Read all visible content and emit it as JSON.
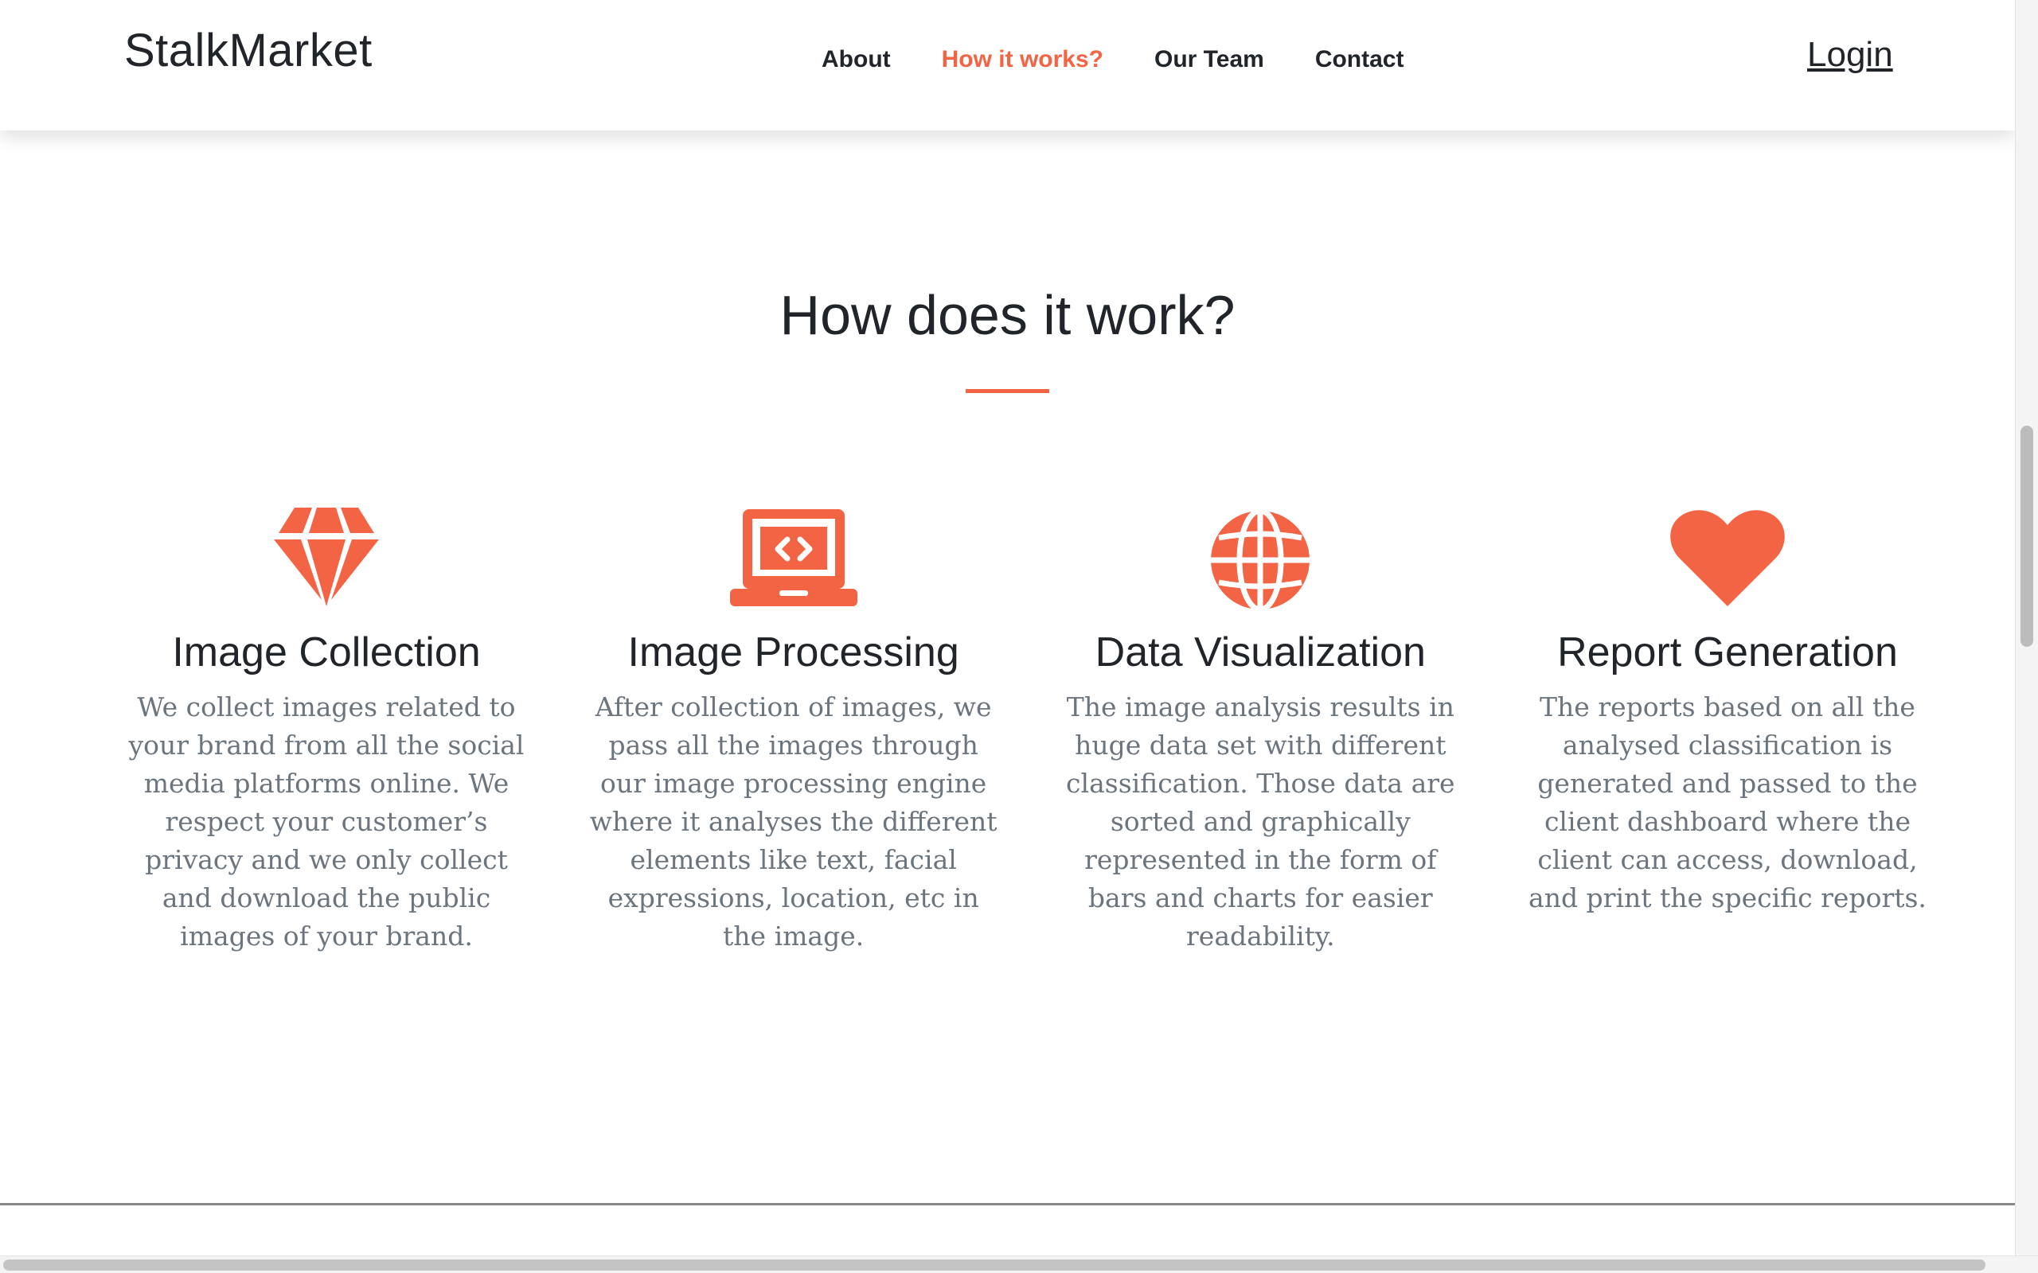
{
  "brand": "StalkMarket",
  "nav": {
    "links": [
      "About",
      "How it works?",
      "Our Team",
      "Contact"
    ],
    "active": "How it works?",
    "login": "Login"
  },
  "section": {
    "title": "How does it work?",
    "features": [
      {
        "icon": "gem-icon",
        "title": "Image Collection",
        "text": "We collect images related to your brand from all the social media platforms online. We respect your customer’s privacy and we only collect and download the public images of your brand."
      },
      {
        "icon": "laptop-code-icon",
        "title": "Image Processing",
        "text": "After collection of images, we pass all the images through our image processing engine where it analyses the different elements like text, facial expressions, location, etc in the image."
      },
      {
        "icon": "globe-icon",
        "title": "Data Visualization",
        "text": "The image analysis results in huge data set with different classification. Those data are sorted and graphically represented in the form of bars and charts for easier readability."
      },
      {
        "icon": "heart-icon",
        "title": "Report Generation",
        "text": "The reports based on all the analysed classification is generated and passed to the client dashboard where the client can access, download, and print the specific reports."
      }
    ]
  },
  "colors": {
    "accent": "#f26444",
    "text_dark": "#212529",
    "text_muted": "#6c757d"
  }
}
